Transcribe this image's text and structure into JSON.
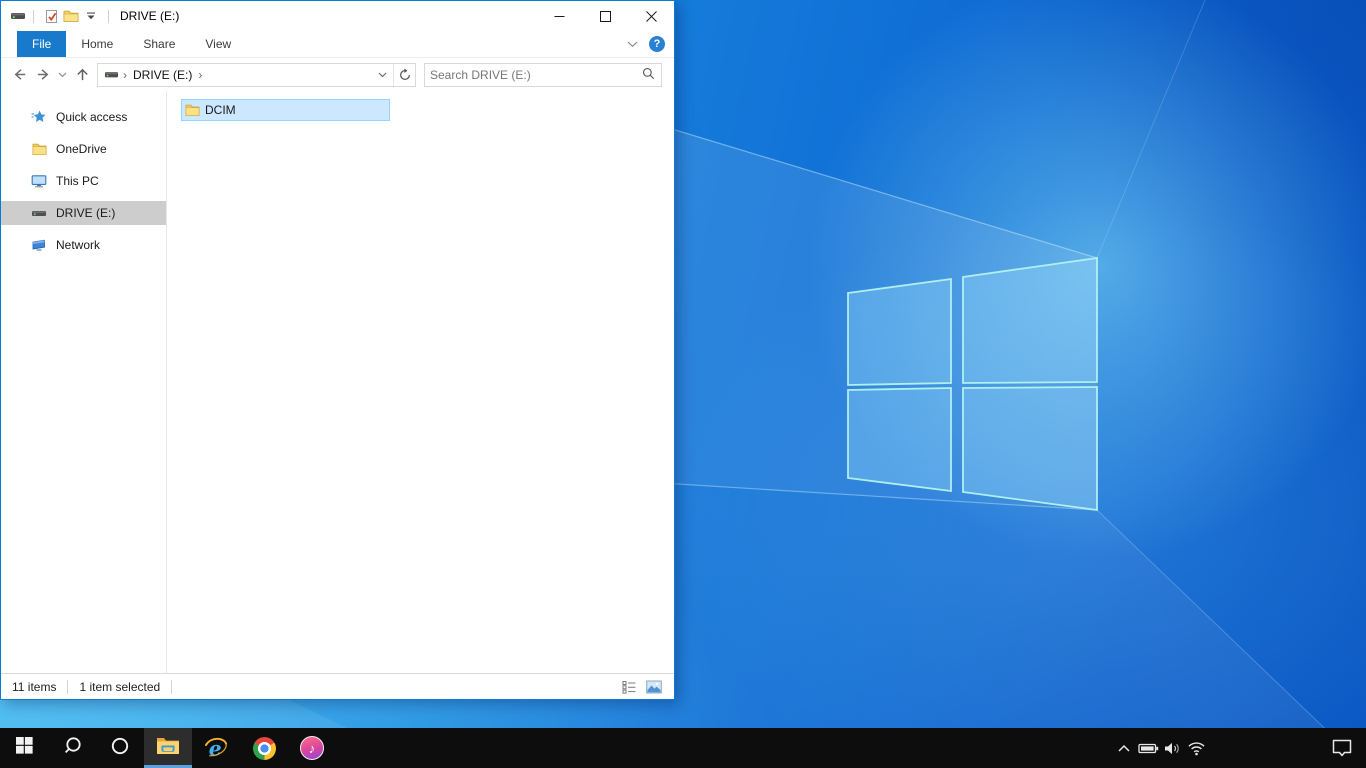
{
  "window": {
    "title_bar": {
      "title": "DRIVE (E:)",
      "qat": {
        "icons": [
          "drive-icon",
          "properties-check-icon",
          "new-folder-icon",
          "customize-qat-caret"
        ]
      },
      "caption_buttons": [
        "minimize",
        "maximize",
        "close"
      ]
    },
    "ribbon": {
      "tabs": [
        {
          "label": "File",
          "active": true
        },
        {
          "label": "Home",
          "active": false
        },
        {
          "label": "Share",
          "active": false
        },
        {
          "label": "View",
          "active": false
        }
      ],
      "expand_ribbon_icon": "chevron-down-icon",
      "help_glyph": "?"
    },
    "address_bar": {
      "nav_icons": [
        "back-arrow",
        "forward-arrow",
        "recent-locations-chevron",
        "up-arrow"
      ],
      "breadcrumb": {
        "root_icon": "drive-icon",
        "segment": "DRIVE (E:)",
        "chevron": "›"
      },
      "dropdown_icon": "chevron-down-icon",
      "refresh_icon": "refresh-icon",
      "search_placeholder": "Search DRIVE (E:)"
    },
    "sidebar": {
      "items": [
        {
          "label": "Quick access",
          "icon": "star-icon",
          "selected": false
        },
        {
          "label": "OneDrive",
          "icon": "folder-icon",
          "selected": false
        },
        {
          "label": "This PC",
          "icon": "monitor-icon",
          "selected": false
        },
        {
          "label": "DRIVE (E:)",
          "icon": "drive-icon",
          "selected": true
        },
        {
          "label": "Network",
          "icon": "network-icon",
          "selected": false
        }
      ]
    },
    "files": [
      {
        "name": "DCIM",
        "icon": "folder-icon",
        "selected": true
      }
    ],
    "status_bar": {
      "items_count": "11 items",
      "selection": "1 item selected",
      "view_buttons": [
        "details-view-icon",
        "large-icons-view-icon"
      ]
    }
  },
  "taskbar": {
    "buttons": [
      {
        "name": "start",
        "icon": "windows-logo-icon",
        "active": false
      },
      {
        "name": "search",
        "icon": "search-icon",
        "active": false
      },
      {
        "name": "cortana",
        "icon": "cortana-icon",
        "active": false
      },
      {
        "name": "file-explorer",
        "icon": "file-explorer-icon",
        "active": true
      },
      {
        "name": "internet-explorer",
        "icon": "internet-explorer-icon",
        "active": false
      },
      {
        "name": "chrome",
        "icon": "chrome-icon",
        "active": false
      },
      {
        "name": "itunes",
        "icon": "itunes-icon",
        "active": false
      }
    ],
    "ie_glyph": "e",
    "itunes_glyph": "♪",
    "tray_icons": [
      "hidden-icons-chevron",
      "battery-icon",
      "volume-icon",
      "wifi-icon",
      "action-center-icon"
    ]
  },
  "colors": {
    "accent": "#1979ca",
    "window_border": "#0b7bd7",
    "selection_fill": "#cce8ff",
    "selection_border": "#99d1ff",
    "sidebar_selected": "#cdcdcd",
    "taskbar_bg": "#0d0d0d",
    "taskbar_underline": "#5aa2dd",
    "wallpaper_light": "#2f9fe8",
    "wallpaper_dark": "#0956c2"
  }
}
